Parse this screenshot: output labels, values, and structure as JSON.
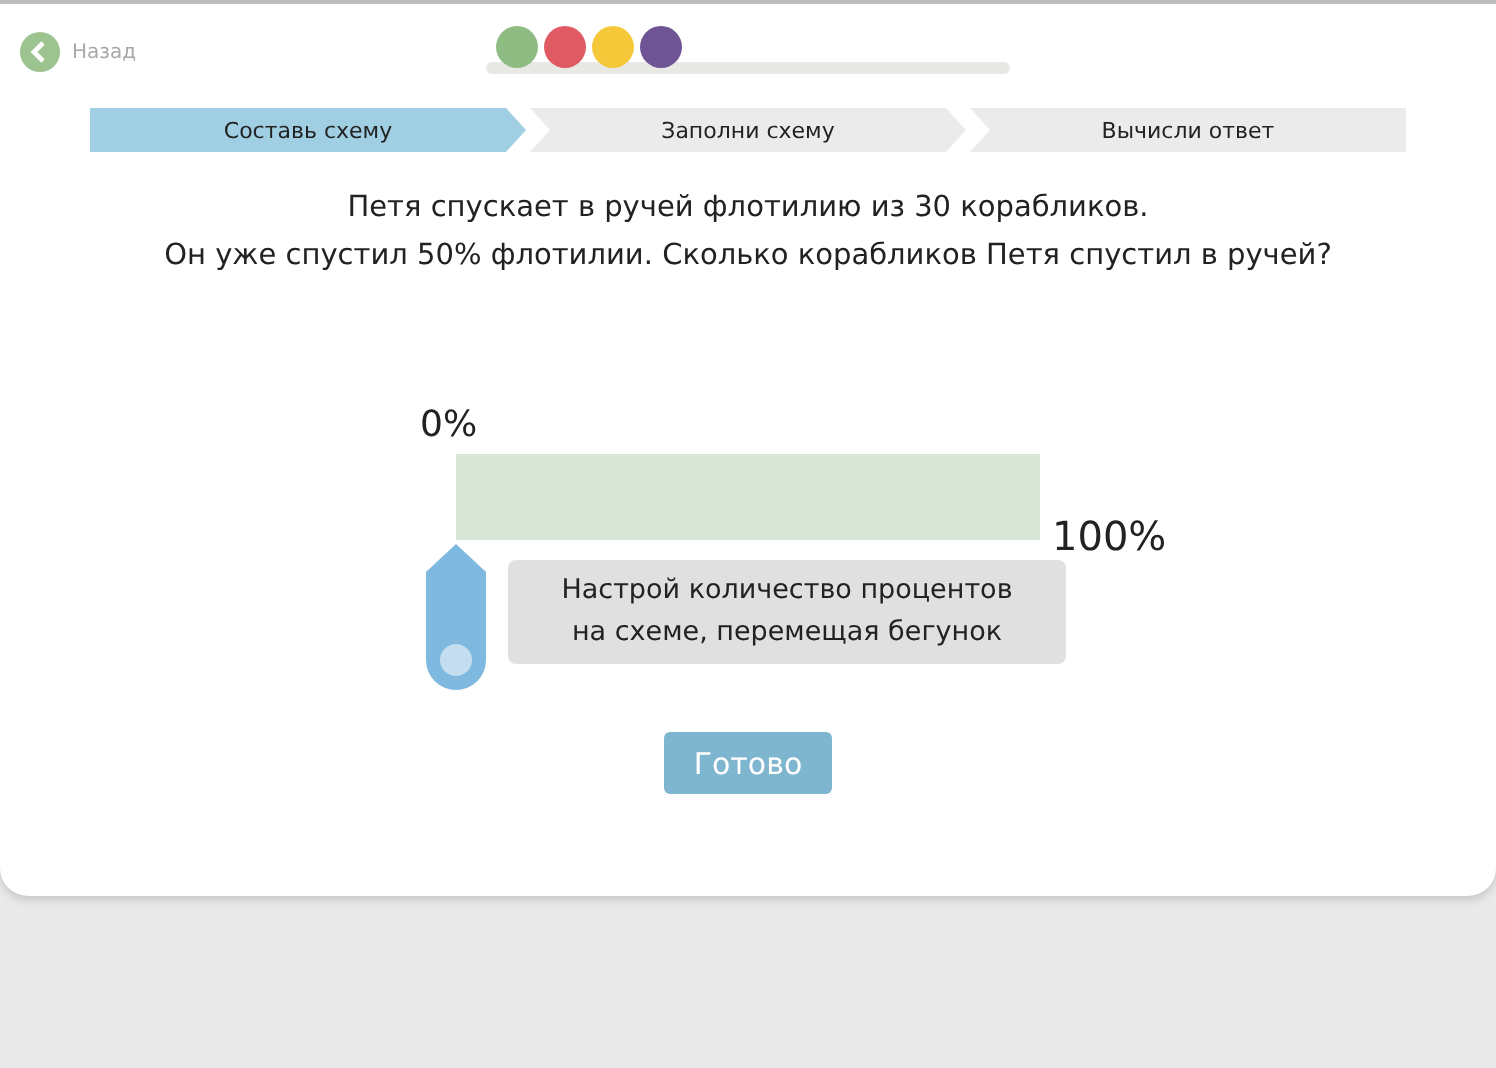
{
  "back_link": "Назад",
  "progress_dots": [
    {
      "color": "#8fbc82"
    },
    {
      "color": "#e05a64"
    },
    {
      "color": "#f5c83a"
    },
    {
      "color": "#6e5494"
    }
  ],
  "steps": [
    {
      "label": "Составь схему",
      "selected": true
    },
    {
      "label": "Заполни схему",
      "selected": false
    },
    {
      "label": "Вычисли ответ",
      "selected": false
    }
  ],
  "problem": [
    "Петя спускает в ручей флотилию из 30 корабликов.",
    "Он уже спустил 50% флотилии. Сколько корабликов Петя спустил в ручей?"
  ],
  "scheme": {
    "start_label": "0%",
    "end_label": "100%",
    "slider": {
      "level": 0
    },
    "hint": "Настрой количество процентов на схеме, перемещая бегунок"
  },
  "done_button": {
    "label": "Готово",
    "disabled": true
  }
}
